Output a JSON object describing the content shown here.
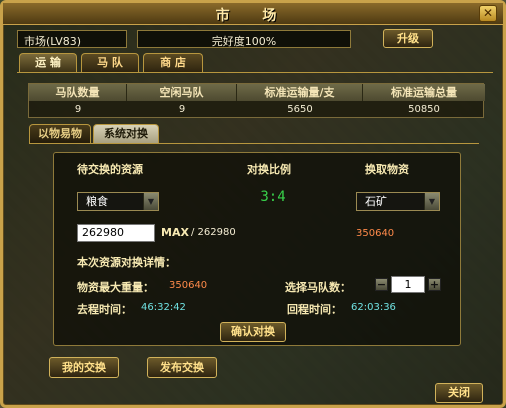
{
  "window": {
    "title": "市 场",
    "close_icon": "close-x-icon"
  },
  "header": {
    "market_level": "市场(LV83)",
    "condition": "完好度100%",
    "upgrade_label": "升级"
  },
  "tabs": [
    {
      "label": "运 输",
      "active": true
    },
    {
      "label": "马 队",
      "active": false
    },
    {
      "label": "商 店",
      "active": false
    }
  ],
  "stats": {
    "headers": [
      "马队数量",
      "空闲马队",
      "标准运输量/支",
      "标准运输总量"
    ],
    "values": [
      "9",
      "9",
      "5650",
      "50850"
    ]
  },
  "subtabs": [
    {
      "label": "以物易物",
      "active": false
    },
    {
      "label": "系统对换",
      "active": true
    }
  ],
  "exchange": {
    "source_header": "待交换的资源",
    "ratio_header": "对换比例",
    "target_header": "换取物资",
    "ratio_value": "3:4",
    "source_selected": "粮食",
    "target_selected": "石矿",
    "amount_input": "262980",
    "max_label": "MAX",
    "max_value": "/ 262980",
    "target_amount": "350640",
    "details_title": "本次资源对换详情：",
    "max_weight_label": "物资最大重量：",
    "max_weight_value": "350640",
    "teams_label": "选择马队数：",
    "teams_value": "1",
    "minus_label": "−",
    "plus_label": "+",
    "go_time_label": "去程时间：",
    "go_time_value": "46:32:42",
    "return_time_label": "回程时间：",
    "return_time_value": "62:03:36",
    "confirm_label": "确认对换"
  },
  "footer": {
    "my_exchange_label": "我的交换",
    "publish_exchange_label": "发布交换",
    "close_label": "关闭"
  },
  "colors": {
    "frame_gold": "#c9a24a",
    "highlight_red": "#ff8a4a",
    "time_cyan": "#6fe0e0",
    "ratio_green": "#38d04a"
  }
}
